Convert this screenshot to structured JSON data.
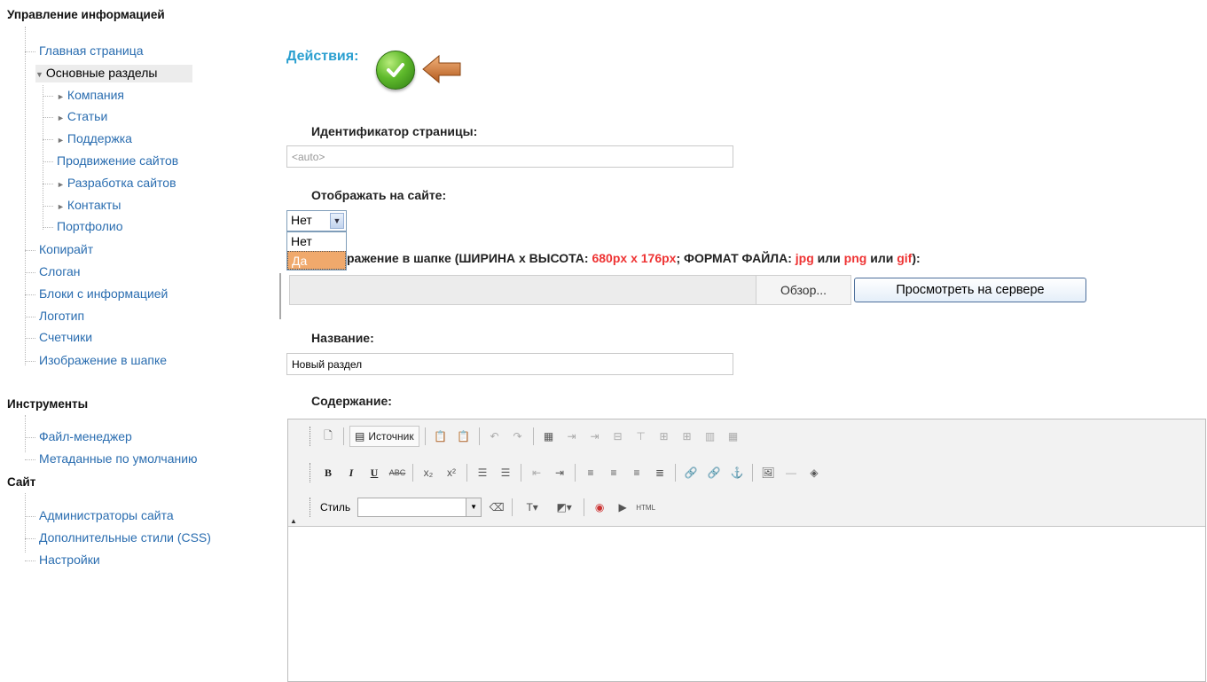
{
  "sidebar": {
    "info_title": "Управление информацией",
    "items": {
      "home": "Главная страница",
      "main_sections": "Основные разделы",
      "company": "Компания",
      "articles": "Статьи",
      "support": "Поддержка",
      "seo": "Продвижение сайтов",
      "dev": "Разработка сайтов",
      "contacts": "Контакты",
      "portfolio": "Портфолио",
      "copyright": "Копирайт",
      "slogan": "Слоган",
      "blocks": "Блоки с информацией",
      "logo": "Логотип",
      "counters": "Счетчики",
      "header_image": "Изображение в шапке"
    },
    "tools_title": "Инструменты",
    "tools": {
      "file_manager": "Файл-менеджер",
      "default_meta": "Метаданные по умолчанию"
    },
    "site_title": "Сайт",
    "site": {
      "admins": "Администраторы сайта",
      "css": "Дополнительные стили (CSS)",
      "settings": "Настройки"
    }
  },
  "main": {
    "actions_label": "Действия:",
    "page_id_label": "Идентификатор страницы:",
    "page_id_placeholder": "<auto>",
    "show_label": "Отображать на сайте:",
    "show_value": "Нет",
    "show_options": [
      "Нет",
      "Да"
    ],
    "image_label_prefix": "ражение в шапке (ШИРИНА x ВЫСОТА: ",
    "image_size": "680px x 176px",
    "image_label_mid": "; ФОРМАТ ФАЙЛА: ",
    "fmt_jpg": "jpg",
    "or1": " или ",
    "fmt_png": "png",
    "or2": " или ",
    "fmt_gif": "gif",
    "image_label_end": "):",
    "browse_label": "Обзор...",
    "server_label": "Просмотреть на сервере",
    "name_label": "Название:",
    "name_value": "Новый раздел",
    "content_label": "Содержание:"
  },
  "editor": {
    "source_label": "Источник",
    "style_label": "Стиль"
  },
  "colors": {
    "link": "#2a6db0",
    "actions": "#2a9fd0",
    "highlight": "#f0a96c",
    "accent_red": "#e33"
  }
}
